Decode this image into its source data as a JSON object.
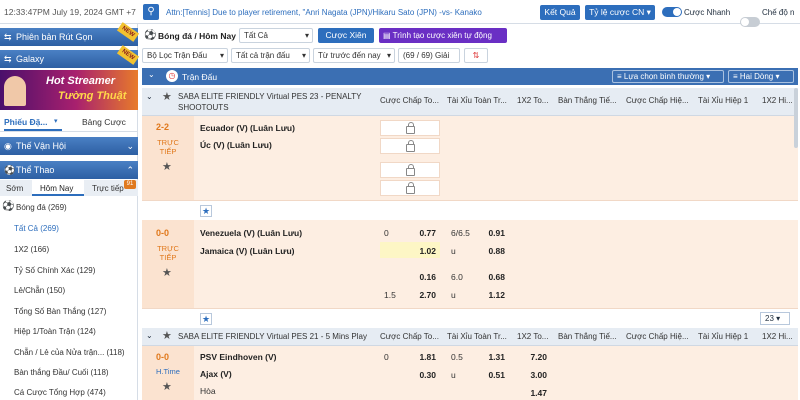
{
  "topbar": {
    "clock": "12:33:47PM July 19, 2024 GMT +7",
    "ticker": "Attn:[Tennis] Due to player retirement, \"Anri Nagata (JPN)/Hikaru Sato (JPN) -vs- Kanako",
    "results_btn": "Kết Quả",
    "odds_format": "Tỷ lệ cược CN",
    "quick_bet_label": "Cược Nhanh",
    "mode_label": "Chế độ n"
  },
  "sidebar": {
    "lobby_label": "Phiên bản Rút Gọn",
    "galaxy_label": "Galaxy",
    "banner_line1": "Hot Streamer",
    "banner_line2": "Tường Thuật",
    "tabs": [
      "Phiếu Đặ...",
      "Bảng Cược"
    ],
    "olympics": "Thế Vận Hội",
    "sports": "Thể Thao",
    "day_tabs": [
      "Sớm",
      "Hôm Nay",
      "Trực tiếp"
    ],
    "live_badge": "91",
    "football_label": "Bóng đá",
    "football_count": "(269)",
    "items": [
      {
        "label": "Tất Cả (269)"
      },
      {
        "label": "1X2 (166)"
      },
      {
        "label": "Tỷ Số Chính Xác (129)"
      },
      {
        "label": "Lẻ/Chẵn (150)"
      },
      {
        "label": "Tổng Số Bàn Thắng (127)"
      },
      {
        "label": "Hiệp 1/Toàn Trận (124)"
      },
      {
        "label": "Chẵn / Lẻ của Nửa trận... (118)"
      },
      {
        "label": "Bàn thắng Đầu/ Cuối (118)"
      },
      {
        "label": "Cá Cược Tổng Hợp (474)"
      }
    ]
  },
  "filters": {
    "sport_title": "Bóng đá / Hôm Nay",
    "select_all": "Tất Cả",
    "parlay_btn": "Cược Xiên",
    "create_parlay_btn": "Trình tạo cược xiên tự động",
    "league_filter": "Bộ Lọc Trận Đấu",
    "all_matches": "Tất cả trận đấu",
    "sort_time": "Từ trước đến nay",
    "count": "(69 / 69) Giải"
  },
  "section": {
    "title": "Trận Đấu",
    "sort_select": "Lựa chọn bình thường",
    "line_select": "Hai Dòng"
  },
  "columns": [
    "Cược Chấp To...",
    "Tài Xỉu Toàn Tr...",
    "1X2 To...",
    "Bàn Thắng Tiế...",
    "Cược Chấp Hiệ...",
    "Tài Xỉu Hiệp 1",
    "1X2 Hi..."
  ],
  "leagues": [
    {
      "name": "SABA ELITE FRIENDLY Virtual PES 23 - PENALTY SHOOTOUTS"
    },
    {
      "name": "SABA ELITE FRIENDLY Virtual PES 21 - 5 Mins Play"
    }
  ],
  "matches": [
    {
      "score": "2-2",
      "status": "TRỰC TIẾP",
      "home": "Ecuador (V) (Luân Lưu)",
      "away": "Úc (V) (Luân Lưu)"
    },
    {
      "score": "0-0",
      "status": "TRỰC TIẾP",
      "home": "Venezuela (V) (Luân Lưu)",
      "away": "Jamaica (V) (Luân Lưu)",
      "hdp1": [
        "0",
        "0.77"
      ],
      "hdp2": [
        "",
        "1.02"
      ],
      "ou1": [
        "6/6.5",
        "0.91"
      ],
      "ou2": [
        "u",
        "0.88"
      ],
      "hdp3": [
        "",
        "0.16"
      ],
      "hdp4": [
        "1.5",
        "2.70"
      ],
      "ou3": [
        "6.0",
        "0.68"
      ],
      "ou4": [
        "u",
        "1.12"
      ]
    },
    {
      "score": "0-0",
      "status": "H.Time",
      "home": "PSV Eindhoven (V)",
      "away": "Ajax (V)",
      "draw": "Hòa",
      "hdp1": [
        "0",
        "1.81"
      ],
      "hdp2": [
        "",
        "0.30"
      ],
      "ou1": [
        "0.5",
        "1.31"
      ],
      "ou2": [
        "u",
        "0.51"
      ],
      "x12": [
        "7.20",
        "3.00",
        "1.47"
      ]
    }
  ],
  "pager": "23",
  "colors": {
    "accent": "#2d6ebd",
    "score": "#e0781b",
    "row_bg": "#fdeee2"
  }
}
